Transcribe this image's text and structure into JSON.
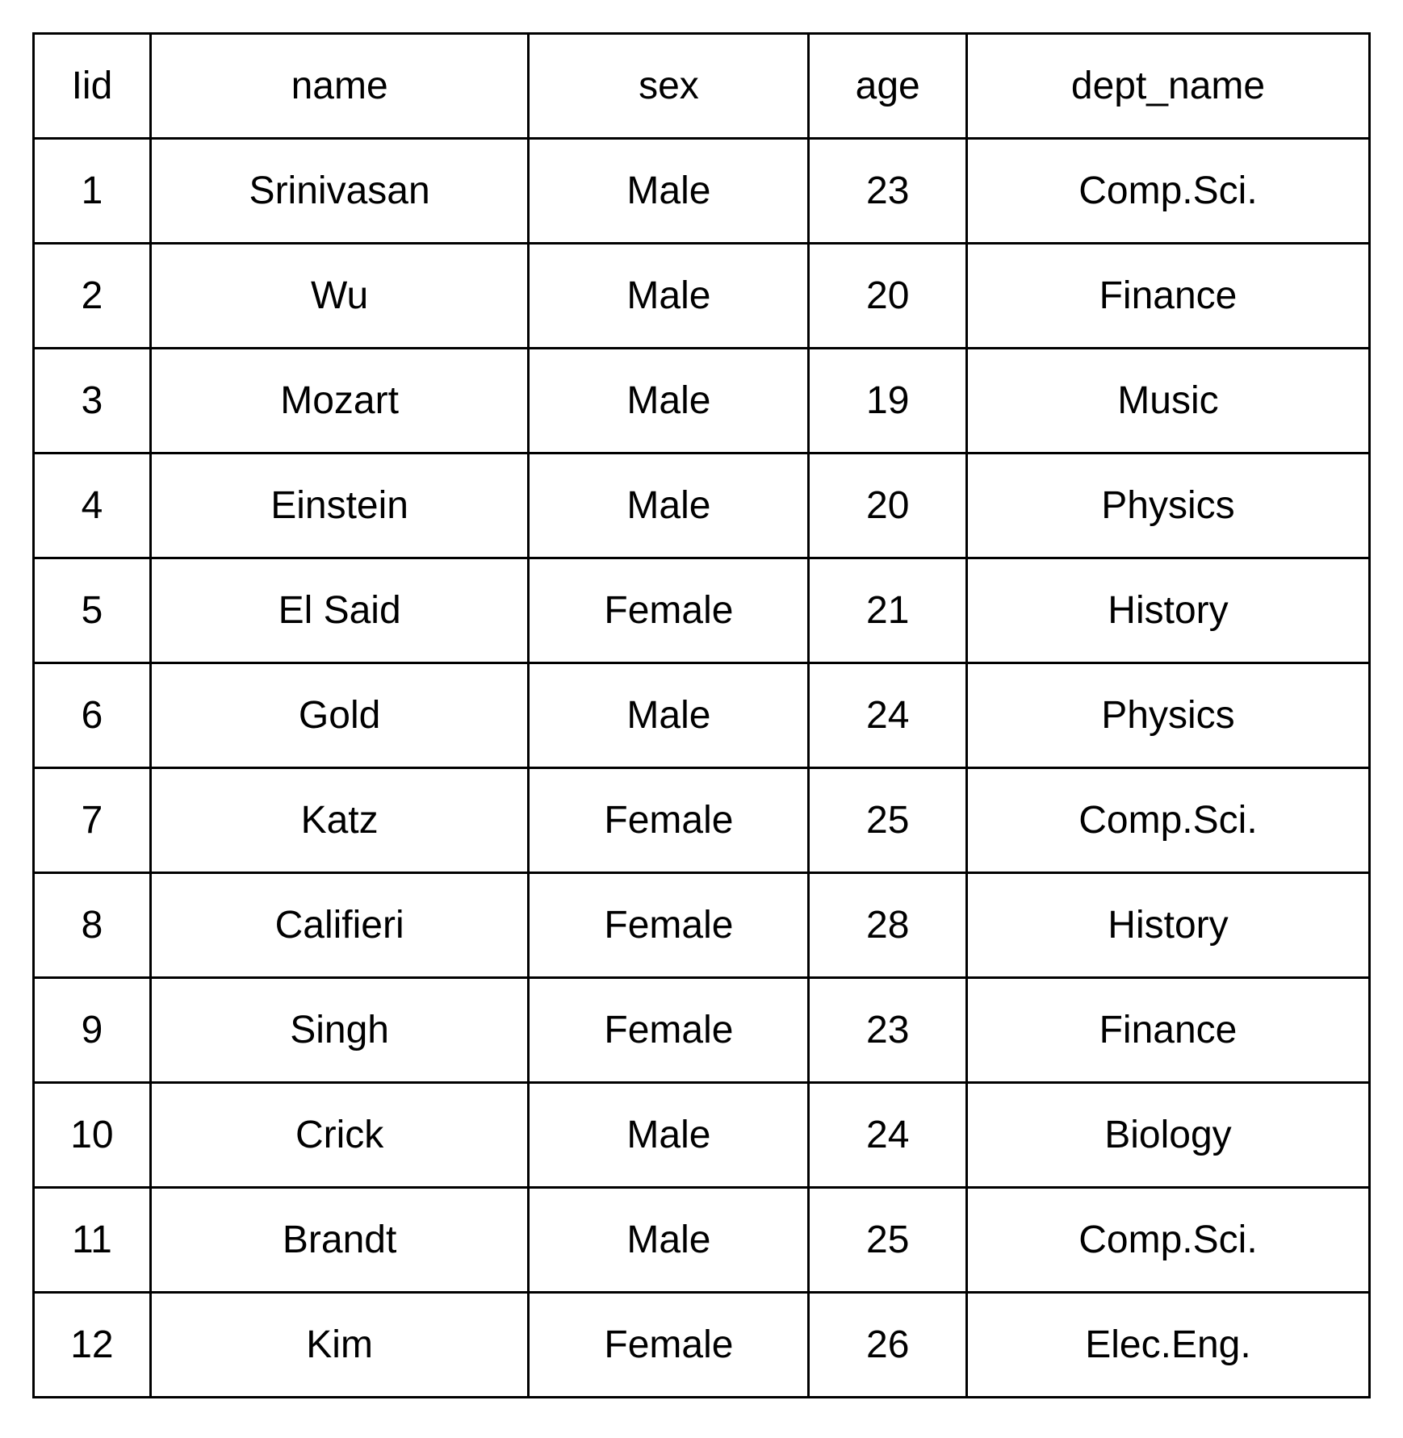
{
  "chart_data": {
    "type": "table",
    "columns": [
      "Iid",
      "name",
      "sex",
      "age",
      "dept_name"
    ],
    "rows": [
      [
        "1",
        "Srinivasan",
        "Male",
        "23",
        "Comp.Sci."
      ],
      [
        "2",
        "Wu",
        "Male",
        "20",
        "Finance"
      ],
      [
        "3",
        "Mozart",
        "Male",
        "19",
        "Music"
      ],
      [
        "4",
        "Einstein",
        "Male",
        "20",
        "Physics"
      ],
      [
        "5",
        "El Said",
        "Female",
        "21",
        "History"
      ],
      [
        "6",
        "Gold",
        "Male",
        "24",
        "Physics"
      ],
      [
        "7",
        "Katz",
        "Female",
        "25",
        "Comp.Sci."
      ],
      [
        "8",
        "Califieri",
        "Female",
        "28",
        "History"
      ],
      [
        "9",
        "Singh",
        "Female",
        "23",
        "Finance"
      ],
      [
        "10",
        "Crick",
        "Male",
        "24",
        "Biology"
      ],
      [
        "11",
        "Brandt",
        "Male",
        "25",
        "Comp.Sci."
      ],
      [
        "12",
        "Kim",
        "Female",
        "26",
        "Elec.Eng."
      ]
    ]
  }
}
